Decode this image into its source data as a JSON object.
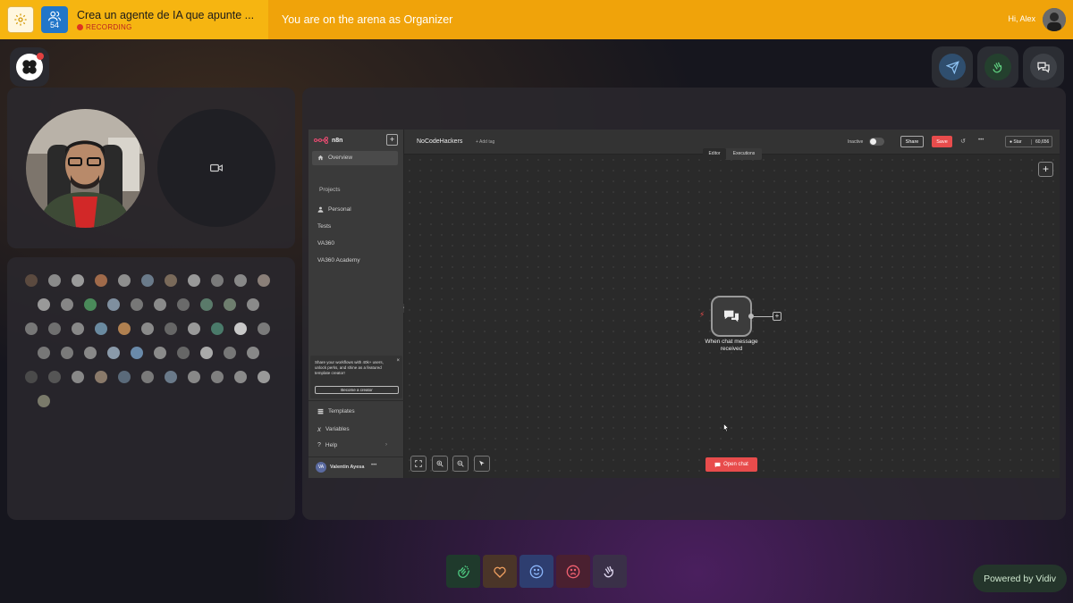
{
  "topbar": {
    "participant_count": "54",
    "session_title": "Crea un agente de IA que apunte ...",
    "recording_label": "RECORDING",
    "arena_text": "You are on the arena as Organizer",
    "greeting": "Hi, Alex"
  },
  "n8n": {
    "brand": "n8n",
    "workflow_name": "NoCodeHackers",
    "add_tag": "+ Add tag",
    "status": "Inactive",
    "share_label": "Share",
    "save_label": "Save",
    "star_label": "Star",
    "star_count": "60,656",
    "tab_editor": "Editor",
    "tab_executions": "Executions",
    "sidebar": {
      "overview": "Overview",
      "projects_heading": "Projects",
      "personal": "Personal",
      "items": [
        "Tests",
        "VA360",
        "VA360 Academy"
      ],
      "promo_text": "Share your workflows with 40k+ users, unlock perks, and shine as a featured template creator!",
      "promo_button": "Become a creator",
      "templates": "Templates",
      "variables": "Variables",
      "help": "Help",
      "user_initials": "VA",
      "user_name": "Valentin Ayesa"
    },
    "node_label_1": "When chat message",
    "node_label_2": "received",
    "open_chat": "Open chat"
  },
  "powered_by": "Powered by Vidiv",
  "colors": {
    "topbar": "#f0a30a",
    "save": "#e84c4c",
    "accent_blue": "#2276c9"
  }
}
